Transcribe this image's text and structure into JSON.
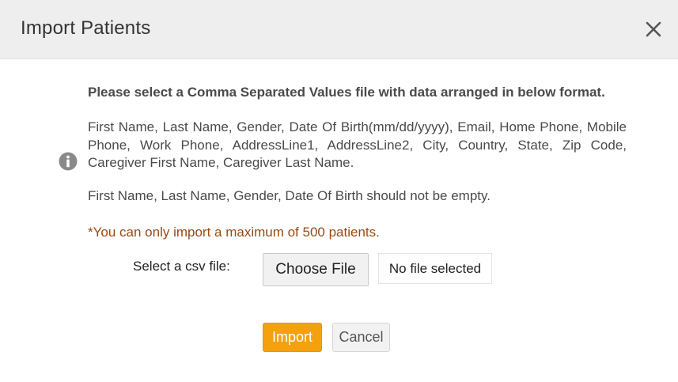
{
  "dialog": {
    "title": "Import Patients",
    "close_icon": "close-icon"
  },
  "body": {
    "info_icon": "info-circle-icon",
    "instruction": "Please select a Comma Separated Values file with data arranged in below format.",
    "fields_format": "First Name, Last Name, Gender, Date Of Birth(mm/dd/yyyy), Email, Home Phone, Mobile Phone, Work Phone, AddressLine1, AddressLine2, City, Country, State, Zip Code, Caregiver First Name, Caregiver Last Name.",
    "required_note": "First Name, Last Name, Gender, Date Of Birth should not be empty.",
    "limit_note": "*You can only import a maximum of 500 patients."
  },
  "file": {
    "label": "Select a csv file:",
    "choose_button": "Choose File",
    "status": "No file selected"
  },
  "actions": {
    "import_label": "Import",
    "cancel_label": "Cancel"
  },
  "colors": {
    "primary_button": "#f5a00f",
    "warning_text": "#9a4a12",
    "header_bg": "#eeeeee"
  }
}
